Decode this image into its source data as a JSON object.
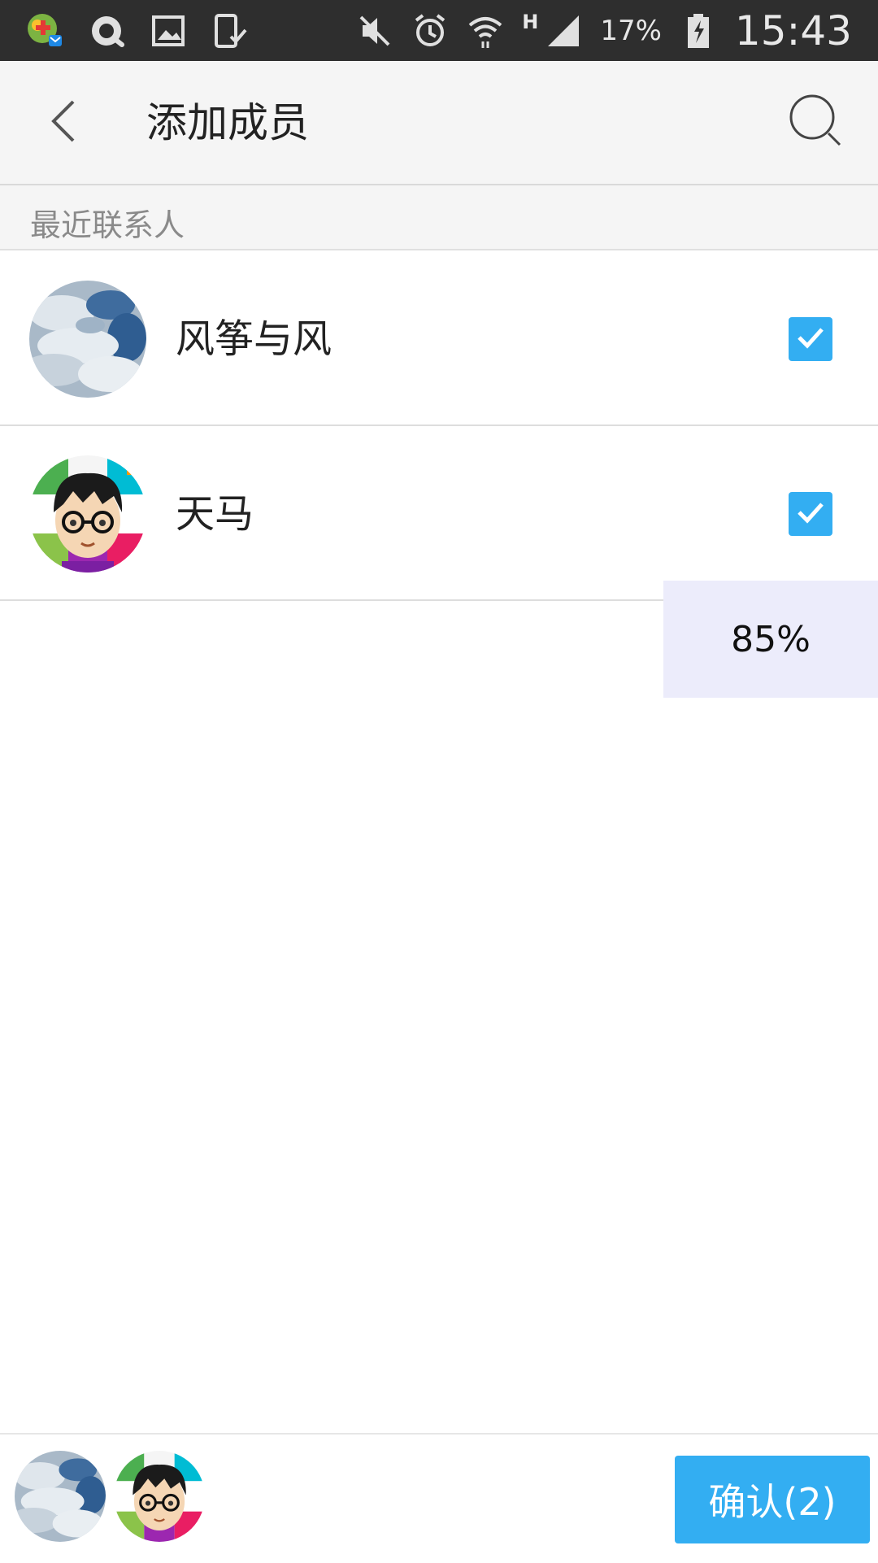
{
  "status_bar": {
    "battery_percent": "17%",
    "time": "15:43",
    "network_type": "H",
    "left_icons": [
      "app-badge-icon",
      "qq-icon",
      "image-icon",
      "device-check-icon"
    ],
    "right_icons": [
      "mute-icon",
      "alarm-icon",
      "wifi-icon",
      "signal-icon",
      "battery-charging-icon"
    ]
  },
  "app_bar": {
    "title": "添加成员",
    "back_icon": "chevron-left-icon",
    "search_icon": "search-icon"
  },
  "section": {
    "recent_label": "最近联系人"
  },
  "contacts": [
    {
      "name": "风筝与风",
      "avatar": "cloud-sky-avatar",
      "checked": true
    },
    {
      "name": "天马",
      "avatar": "cartoon-boy-glasses-avatar",
      "checked": true
    }
  ],
  "progress_toast": {
    "text": "85%"
  },
  "bottom_bar": {
    "confirm_label": "确认(2)",
    "selected_avatars": [
      "cloud-sky-avatar",
      "cartoon-boy-glasses-avatar"
    ]
  },
  "colors": {
    "accent": "#33aef2",
    "status_bar_bg": "#2e2e2e",
    "app_bar_bg": "#f5f5f5",
    "toast_bg": "#ececfb"
  }
}
